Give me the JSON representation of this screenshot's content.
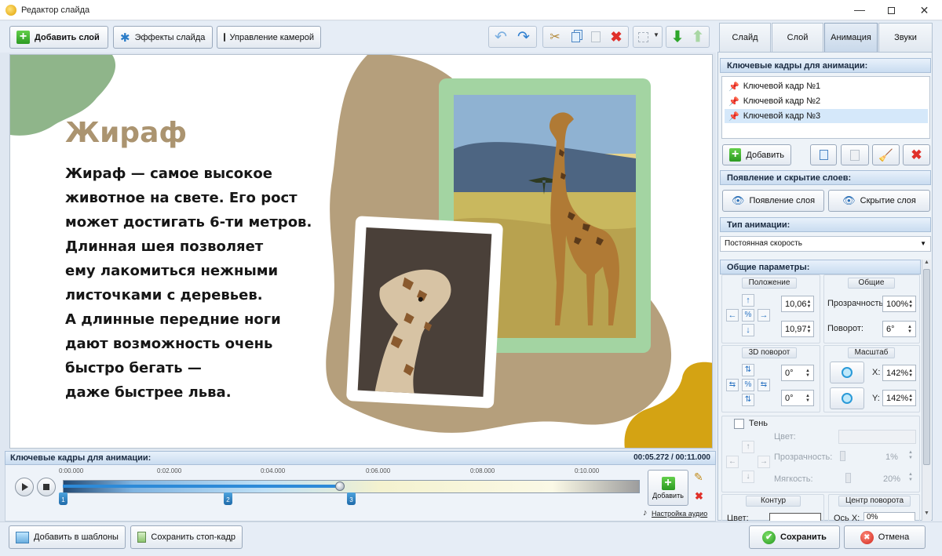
{
  "window": {
    "title": "Редактор слайда"
  },
  "toolbar": {
    "add_layer": "Добавить слой",
    "slide_effects": "Эффекты слайда",
    "camera_control": "Управление камерой"
  },
  "tabs": [
    {
      "label": "Слайд"
    },
    {
      "label": "Слой"
    },
    {
      "label": "Анимация"
    },
    {
      "label": "Звуки"
    }
  ],
  "slide": {
    "title": "Жираф",
    "lines": [
      "Жираф — самое высокое",
      "животное на свете. Его рост",
      "может достигать 6-ти метров.",
      "Длинная шея позволяет",
      "ему лакомиться нежными",
      "листочками с деревьев.",
      "А длинные передние ноги",
      "дают возможность очень",
      "быстро бегать —",
      "даже быстрее льва."
    ],
    "colors": {
      "title": "#ab9470",
      "blob_brown": "#b59f7c",
      "blob_green": "#8fb58a",
      "blob_yellow": "#d4a313",
      "frame_green": "#a3d4a2"
    }
  },
  "keyframes_panel": {
    "header": "Ключевые кадры для анимации:",
    "items": [
      "Ключевой кадр №1",
      "Ключевой кадр №2",
      "Ключевой кадр №3"
    ],
    "selected_index": 2,
    "add_label": "Добавить"
  },
  "appear_section": {
    "header": "Появление и скрытие слоев:",
    "show_label": "Появление слоя",
    "hide_label": "Скрытие слоя"
  },
  "anim_type": {
    "header": "Тип анимации:",
    "value": "Постоянная скорость"
  },
  "params": {
    "header": "Общие параметры:",
    "position_title": "Положение",
    "pos_x": "10,06",
    "pos_y": "10,97",
    "general_title": "Общие",
    "opacity_label": "Прозрачность:",
    "opacity_value": "100%",
    "rotate_label": "Поворот:",
    "rotate_value": "6°",
    "rot3d_title": "3D поворот",
    "rot3d_a": "0°",
    "rot3d_b": "0°",
    "scale_title": "Масштаб",
    "scale_x_label": "X:",
    "scale_x": "142%",
    "scale_y_label": "Y:",
    "scale_y": "142%",
    "shadow_label": "Тень",
    "shadow_color_label": "Цвет:",
    "shadow_opacity_label": "Прозрачность:",
    "shadow_opacity_value": "1%",
    "shadow_soft_label": "Мягкость:",
    "shadow_soft_value": "20%",
    "contour_title": "Контур",
    "contour_color_label": "Цвет:",
    "center_title": "Центр поворота",
    "center_x_label": "Ось X:",
    "center_x_value": "0%"
  },
  "timeline": {
    "header": "Ключевые кадры для анимации:",
    "time": "00:05.272 / 00:11.000",
    "ticks": [
      "0:00.000",
      "0:02.000",
      "0:04.000",
      "0:06.000",
      "0:08.000",
      "0:10.000"
    ],
    "markers": [
      "1",
      "2",
      "3"
    ],
    "add_label": "Добавить",
    "audio_link": "Настройка аудио"
  },
  "bottom": {
    "add_templates": "Добавить в шаблоны",
    "save_frame": "Сохранить стоп-кадр",
    "save": "Сохранить",
    "cancel": "Отмена"
  }
}
